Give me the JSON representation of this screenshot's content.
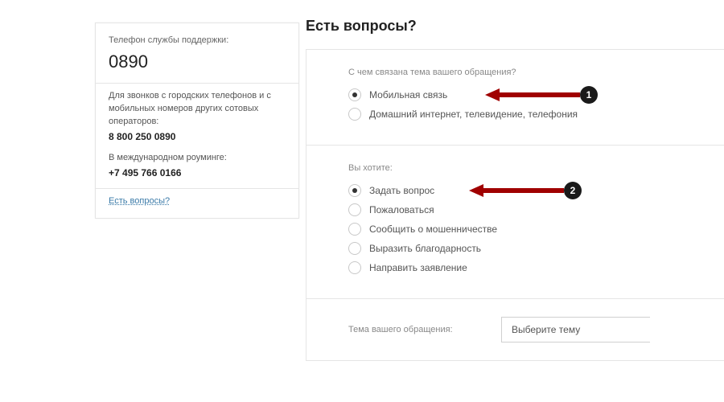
{
  "sidebar": {
    "support_label": "Телефон службы поддержки:",
    "support_number": "0890",
    "landline_note": "Для звонков с городских телефонов и с мобильных номеров других сотовых операторов:",
    "landline_phone": "8 800 250 0890",
    "roaming_note": "В международном роуминге:",
    "roaming_phone": "+7 495 766 0166",
    "faq_link": "Есть вопросы?"
  },
  "main": {
    "heading": "Есть вопросы?",
    "topic": {
      "question": "С чем связана тема вашего обращения?",
      "options": [
        {
          "label": "Мобильная связь",
          "selected": true
        },
        {
          "label": "Домашний интернет, телевидение, телефония",
          "selected": false
        }
      ]
    },
    "intent": {
      "question": "Вы хотите:",
      "options": [
        {
          "label": "Задать вопрос",
          "selected": true
        },
        {
          "label": "Пожаловаться",
          "selected": false
        },
        {
          "label": "Сообщить о мошенничестве",
          "selected": false
        },
        {
          "label": "Выразить благодарность",
          "selected": false
        },
        {
          "label": "Направить заявление",
          "selected": false
        }
      ]
    },
    "subject": {
      "label": "Тема вашего обращения:",
      "placeholder": "Выберите тему"
    }
  },
  "annotations": {
    "badge1": "1",
    "badge2": "2"
  }
}
